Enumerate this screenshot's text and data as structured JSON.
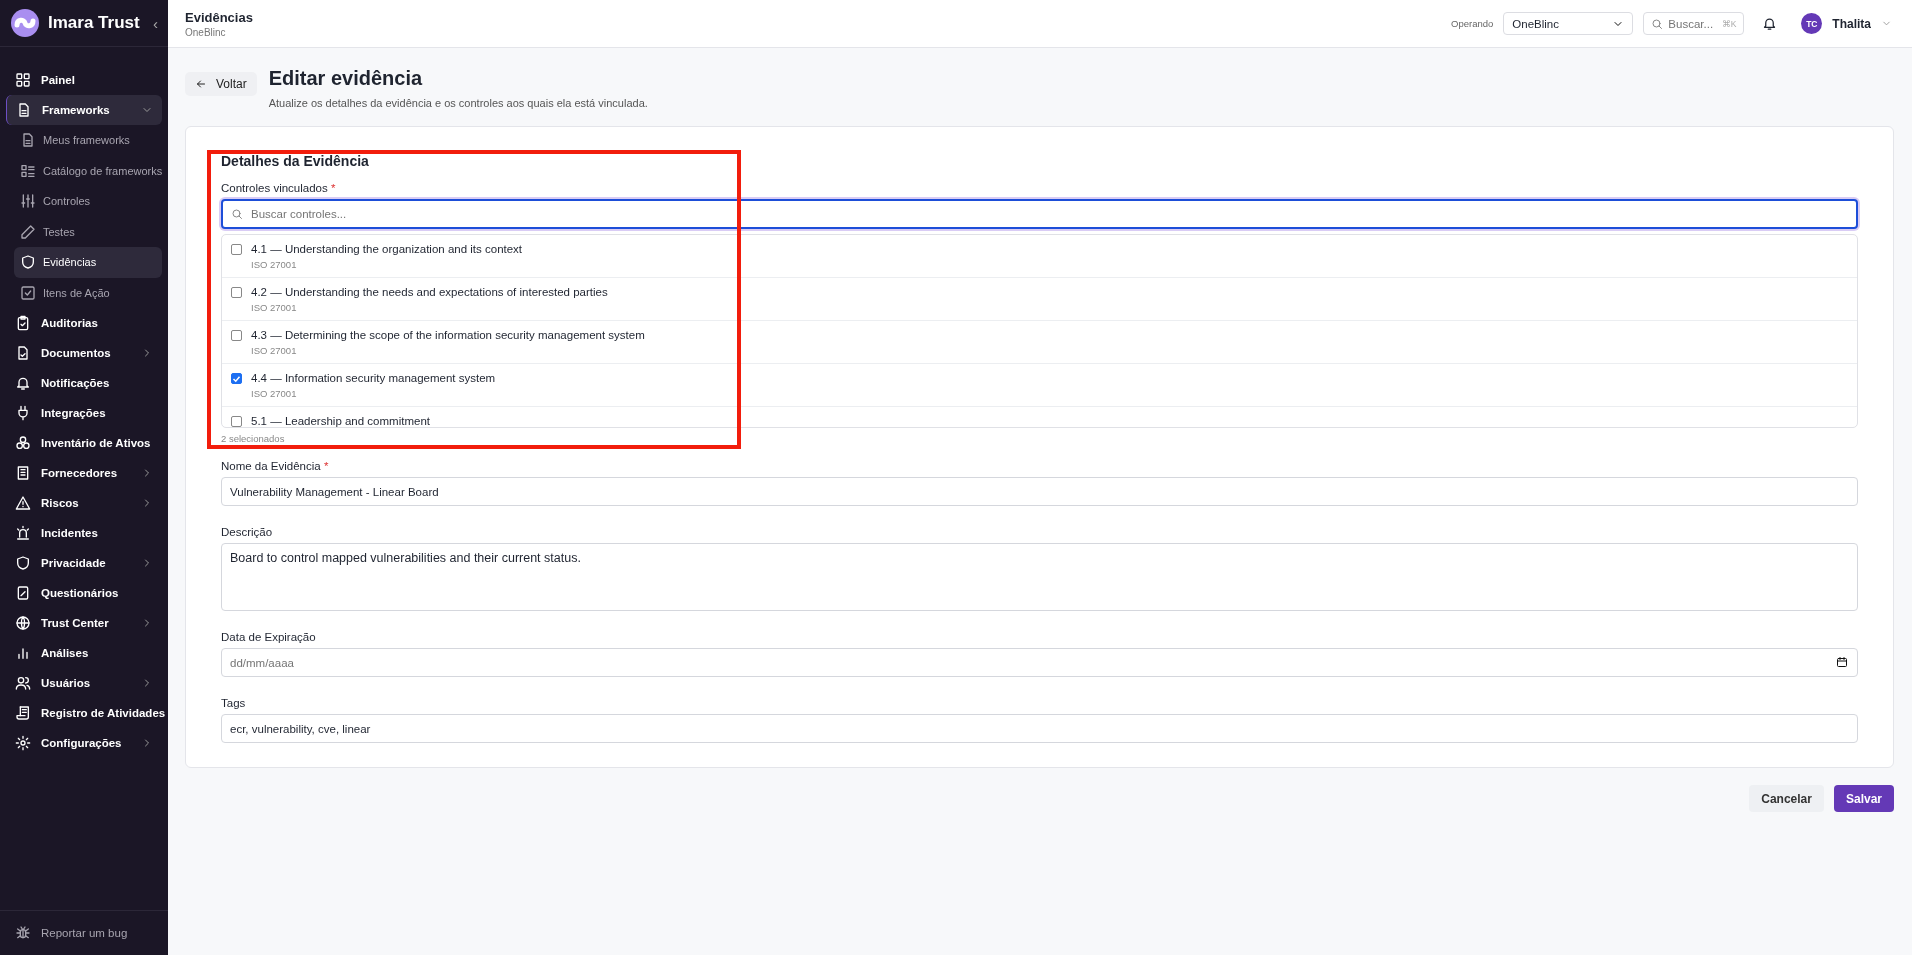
{
  "sidebar": {
    "brand": "Imara Trust",
    "collapse": "‹",
    "items": [
      {
        "label": "Painel",
        "selected": false,
        "expandable": false
      },
      {
        "label": "Frameworks",
        "selected": true,
        "expandable": true,
        "expanded": true,
        "children": [
          {
            "label": "Meus frameworks",
            "selected": false
          },
          {
            "label": "Catálogo de frameworks",
            "selected": false
          },
          {
            "label": "Controles",
            "selected": false
          },
          {
            "label": "Testes",
            "selected": false
          },
          {
            "label": "Evidências",
            "selected": true
          },
          {
            "label": "Itens de Ação",
            "selected": false
          }
        ]
      },
      {
        "label": "Auditorias",
        "selected": false,
        "expandable": false
      },
      {
        "label": "Documentos",
        "selected": false,
        "expandable": true,
        "expanded": false
      },
      {
        "label": "Notificações",
        "selected": false,
        "expandable": false
      },
      {
        "label": "Integrações",
        "selected": false,
        "expandable": false
      },
      {
        "label": "Inventário de Ativos",
        "selected": false,
        "expandable": false
      },
      {
        "label": "Fornecedores",
        "selected": false,
        "expandable": true,
        "expanded": false
      },
      {
        "label": "Riscos",
        "selected": false,
        "expandable": true,
        "expanded": false
      },
      {
        "label": "Incidentes",
        "selected": false,
        "expandable": false
      },
      {
        "label": "Privacidade",
        "selected": false,
        "expandable": true,
        "expanded": false
      },
      {
        "label": "Questionários",
        "selected": false,
        "expandable": false
      },
      {
        "label": "Trust Center",
        "selected": false,
        "expandable": true,
        "expanded": false
      },
      {
        "label": "Análises",
        "selected": false,
        "expandable": false
      },
      {
        "label": "Usuários",
        "selected": false,
        "expandable": true,
        "expanded": false
      },
      {
        "label": "Registro de Atividades",
        "selected": false,
        "expandable": false
      },
      {
        "label": "Configurações",
        "selected": false,
        "expandable": true,
        "expanded": false
      }
    ],
    "footer": "Reportar um bug"
  },
  "header": {
    "title": "Evidências",
    "subtitle": "OneBlinc",
    "operating_label": "Operando",
    "organization": "OneBlinc",
    "search": {
      "placeholder": "Buscar...",
      "shortcut": "⌘K"
    },
    "user": {
      "initials": "TC",
      "name": "Thalita"
    }
  },
  "page": {
    "back": "Voltar",
    "title": "Editar evidência",
    "description": "Atualize os detalhes da evidência e os controles aos quais ela está vinculada."
  },
  "form": {
    "section_title": "Detalhes da Evidência",
    "controls": {
      "label": "Controles vinculados",
      "required": "*",
      "search": {
        "placeholder": "Buscar controles..."
      },
      "options": [
        {
          "label": "4.1 — Understanding the organization and its context",
          "framework": "ISO 27001",
          "checked": false
        },
        {
          "label": "4.2 — Understanding the needs and expectations of interested parties",
          "framework": "ISO 27001",
          "checked": false
        },
        {
          "label": "4.3 — Determining the scope of the information security management system",
          "framework": "ISO 27001",
          "checked": false
        },
        {
          "label": "4.4 — Information security management system",
          "framework": "ISO 27001",
          "checked": true
        },
        {
          "label": "5.1 — Leadership and commitment",
          "checked": false
        }
      ],
      "count": "2 selecionados"
    },
    "name": {
      "label": "Nome da Evidência",
      "required": "*",
      "value": "Vulnerability Management - Linear Board"
    },
    "description": {
      "label": "Descrição",
      "value": "Board to control mapped vulnerabilities and their current status."
    },
    "expiration": {
      "label": "Data de Expiração",
      "placeholder": "dd/mm/aaaa"
    },
    "tags": {
      "label": "Tags",
      "value": "ecr, vulnerability, cve, linear"
    }
  },
  "actions": [
    {
      "label": "Cancelar",
      "kind": "secondary"
    },
    {
      "label": "Salvar",
      "kind": "primary"
    }
  ]
}
